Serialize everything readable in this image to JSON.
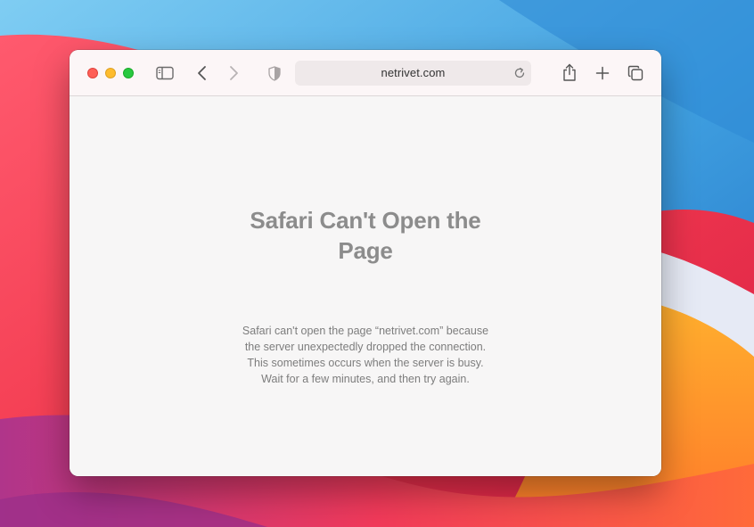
{
  "browser": {
    "address": "netrivet.com"
  },
  "toolbar_icons": {
    "sidebar": "sidebar-icon",
    "back": "chevron-left-icon",
    "forward": "chevron-right-icon",
    "privacy": "shield-icon",
    "reload": "reload-icon",
    "share": "share-icon",
    "new_tab": "plus-icon",
    "tab_overview": "tabs-icon"
  },
  "error": {
    "title": "Safari Can't Open the Page",
    "message": "Safari can't open the page “netrivet.com” because the server unexpectedly dropped the connection. This sometimes occurs when the server is busy. Wait for a few minutes, and then try again."
  },
  "colors": {
    "close": "#fe5f57",
    "minimize": "#febc2e",
    "zoom": "#28c840"
  }
}
